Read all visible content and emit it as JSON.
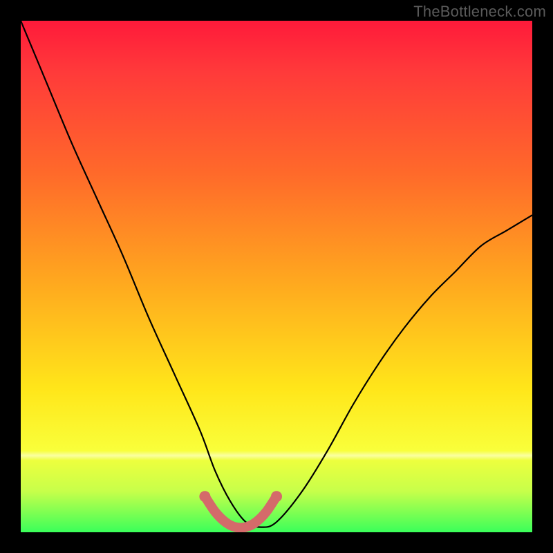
{
  "watermark": "TheBottleneck.com",
  "chart_data": {
    "type": "line",
    "title": "",
    "xlabel": "",
    "ylabel": "",
    "xlim": [
      0,
      100
    ],
    "ylim": [
      0,
      100
    ],
    "annotations": [
      "Rainbow gradient background from red (top) through orange and yellow to green (bottom)"
    ],
    "series": [
      {
        "name": "bottleneck-curve",
        "x": [
          0,
          5,
          10,
          15,
          20,
          25,
          30,
          35,
          38,
          41,
          44,
          47,
          50,
          55,
          60,
          65,
          70,
          75,
          80,
          85,
          90,
          95,
          100
        ],
        "values": [
          100,
          88,
          76,
          65,
          54,
          42,
          31,
          20,
          12,
          6,
          2,
          1,
          2,
          8,
          16,
          25,
          33,
          40,
          46,
          51,
          56,
          59,
          62
        ]
      },
      {
        "name": "highlight-segment",
        "x": [
          36,
          38,
          40,
          42,
          44,
          46,
          48,
          50
        ],
        "values": [
          7,
          4,
          2,
          1,
          1,
          2,
          4,
          7
        ]
      }
    ],
    "background_gradient_stops": [
      {
        "pos": 0.0,
        "color": "#ff1a3a"
      },
      {
        "pos": 0.1,
        "color": "#ff3a3a"
      },
      {
        "pos": 0.3,
        "color": "#ff6a2a"
      },
      {
        "pos": 0.5,
        "color": "#ffa51f"
      },
      {
        "pos": 0.72,
        "color": "#ffe61a"
      },
      {
        "pos": 0.84,
        "color": "#f9ff3a"
      },
      {
        "pos": 0.92,
        "color": "#c7ff4a"
      },
      {
        "pos": 1.0,
        "color": "#3aff5a"
      }
    ]
  }
}
